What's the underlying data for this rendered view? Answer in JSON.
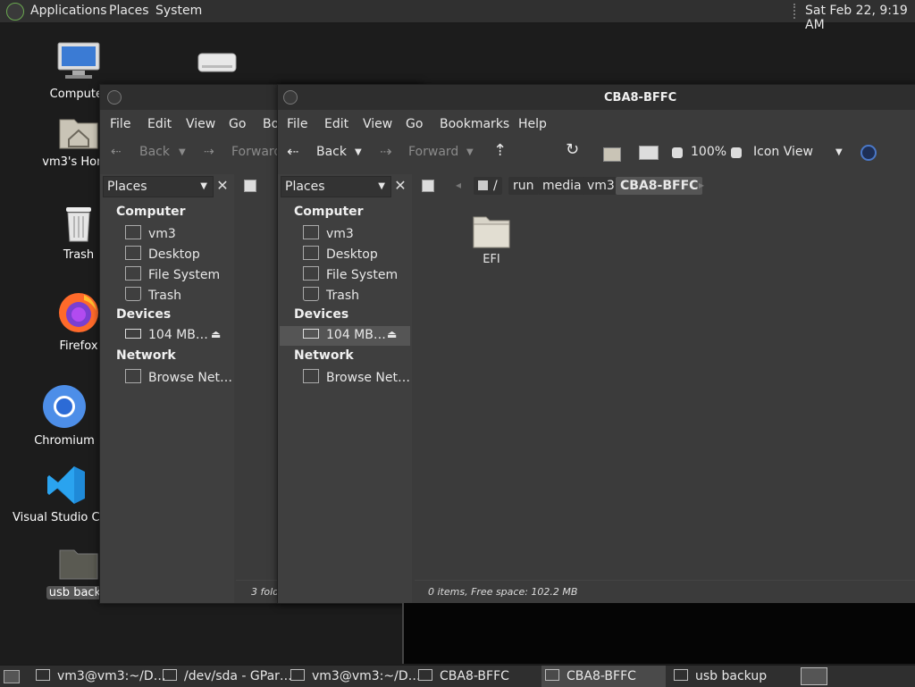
{
  "top_panel": {
    "menus": [
      "Applications",
      "Places",
      "System"
    ],
    "clock": "Sat Feb 22,  9:19 AM"
  },
  "desktop_icons": [
    "Computer",
    "vm3's Home",
    "Trash",
    "Firefox",
    "Chromium",
    "Visual Studio Code",
    "usb backup"
  ],
  "back_window": {
    "menu": [
      "File",
      "Edit",
      "View",
      "Go",
      "Bo"
    ],
    "toolbar": {
      "back": "Back",
      "forward": "Forward"
    },
    "sidebar": {
      "combo": "Places",
      "computer": "Computer",
      "items": [
        "vm3",
        "Desktop",
        "File System",
        "Trash"
      ],
      "devices": "Devices",
      "device_item": "104 MB…",
      "network": "Network",
      "network_item": "Browse Net…"
    },
    "status": "3 fold"
  },
  "front_window": {
    "title": "CBA8-BFFC",
    "menu": [
      "File",
      "Edit",
      "View",
      "Go",
      "Bookmarks",
      "Help"
    ],
    "toolbar": {
      "back": "Back",
      "forward": "Forward",
      "zoom": "100%",
      "view": "Icon View"
    },
    "sidebar": {
      "combo": "Places",
      "computer": "Computer",
      "items": [
        "vm3",
        "Desktop",
        "File System",
        "Trash"
      ],
      "devices": "Devices",
      "device_item": "104 MB…",
      "network": "Network",
      "network_item": "Browse Net…"
    },
    "path": [
      "/",
      "run",
      "media",
      "vm3",
      "CBA8-BFFC"
    ],
    "files": [
      {
        "name": "EFI",
        "icon": "folder-icon"
      }
    ],
    "status": "0 items, Free space: 102.2 MB"
  },
  "taskbar": [
    "vm3@vm3:~/D…",
    "/dev/sda - GPar…",
    "vm3@vm3:~/D…",
    "CBA8-BFFC",
    "CBA8-BFFC",
    "usb backup"
  ],
  "colors": {
    "panel": "#303030",
    "window": "#3b3b3b",
    "sidebar": "#3f3f3f",
    "selection": "#555555",
    "stop_red": "#c0302a",
    "search_blue": "#4a78c8"
  }
}
